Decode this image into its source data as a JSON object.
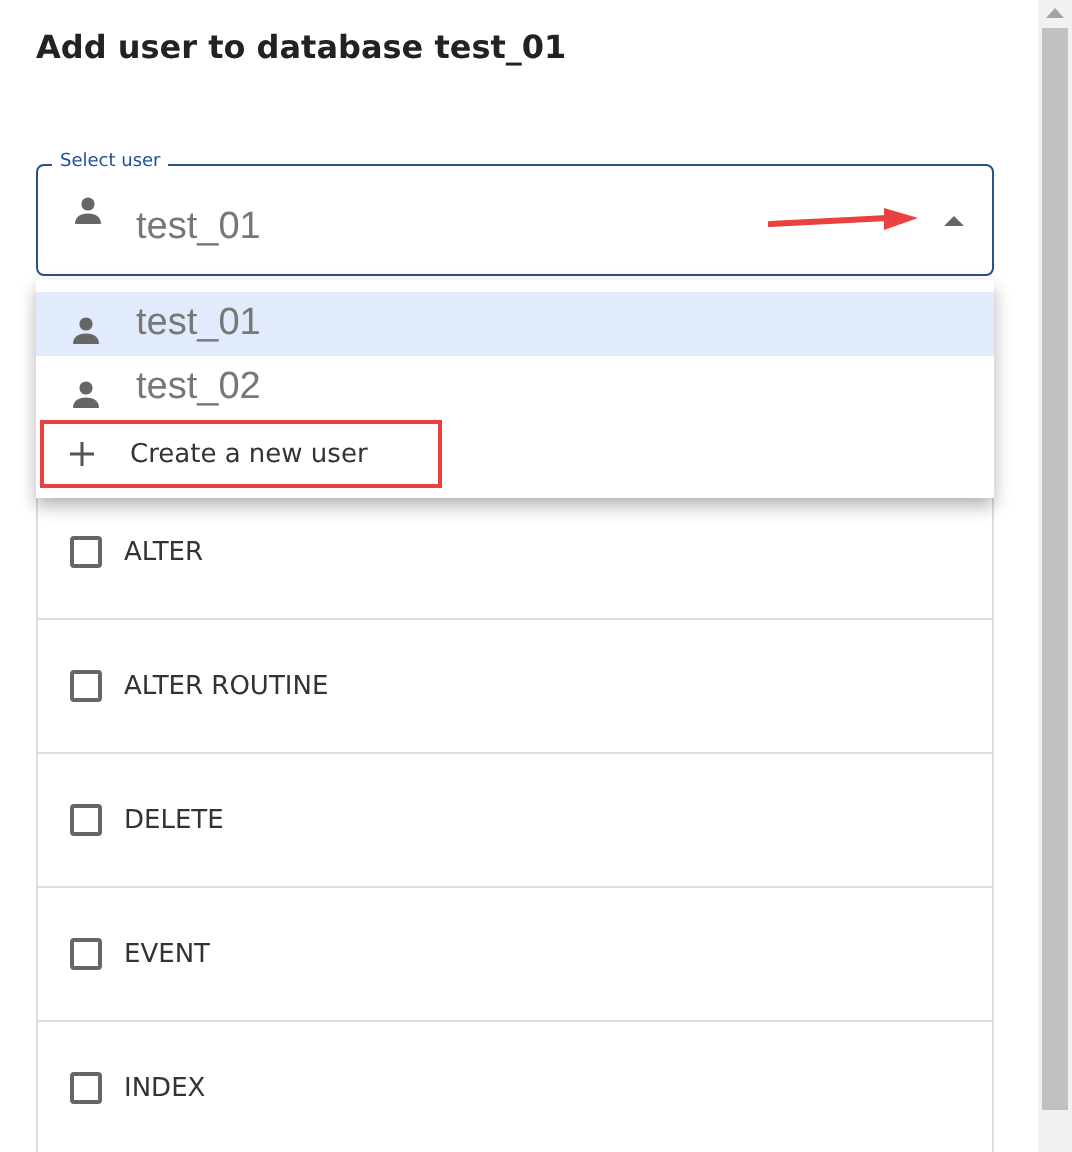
{
  "title": "Add user to database test_01",
  "select_user": {
    "label": "Select user",
    "value": "test_01",
    "expanded": true
  },
  "menu": {
    "options": [
      {
        "label": "test_01",
        "selected": true
      },
      {
        "label": "test_02",
        "selected": false
      }
    ],
    "create_action": "Create a new user"
  },
  "privileges": [
    {
      "label": "ALTER",
      "checked": false
    },
    {
      "label": "ALTER ROUTINE",
      "checked": false
    },
    {
      "label": "DELETE",
      "checked": false
    },
    {
      "label": "EVENT",
      "checked": false
    },
    {
      "label": "INDEX",
      "checked": false
    }
  ]
}
